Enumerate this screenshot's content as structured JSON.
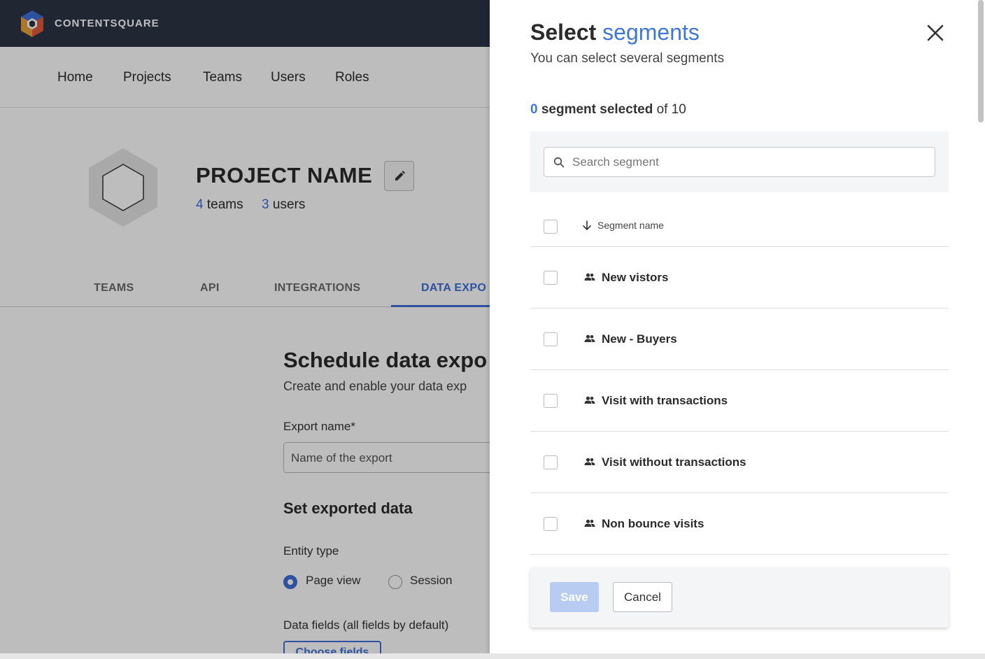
{
  "app": {
    "brand": "CONTENTSQUARE",
    "nav": [
      "Home",
      "Projects",
      "Teams",
      "Users",
      "Roles"
    ],
    "active_nav": "Projects",
    "project": {
      "name": "PROJECT NAME",
      "teams_count": "4",
      "teams_label": "teams",
      "users_count": "3",
      "users_label": "users"
    },
    "tabs": [
      "TEAMS",
      "API",
      "INTEGRATIONS",
      "DATA EXPO"
    ],
    "active_tab": "DATA EXPO",
    "schedule": {
      "title": "Schedule data expo",
      "subtitle": "Create and enable your data exp",
      "export_name_label": "Export name*",
      "export_name_placeholder": "Name of the export",
      "set_data_heading": "Set exported data",
      "entity_type_label": "Entity type",
      "entity_options": [
        "Page view",
        "Session"
      ],
      "entity_selected": "Page view",
      "data_fields_label": "Data fields (all fields by default)",
      "choose_fields_button": "Choose fields"
    }
  },
  "drawer": {
    "title_prefix": "Select",
    "title_highlight": "segments",
    "subtitle": "You can select several segments",
    "selected_count": "0",
    "selected_label": "segment selected",
    "total_label": "of 10",
    "search_placeholder": "Search segment",
    "column_header": "Segment name",
    "segments": [
      "New vistors",
      "New - Buyers",
      "Visit with transactions",
      "Visit without transactions",
      "Non bounce visits"
    ],
    "save_label": "Save",
    "cancel_label": "Cancel"
  },
  "colors": {
    "accent": "#3f78d6",
    "topbar": "#2c3546",
    "save_disabled": "#b8ccf1"
  }
}
